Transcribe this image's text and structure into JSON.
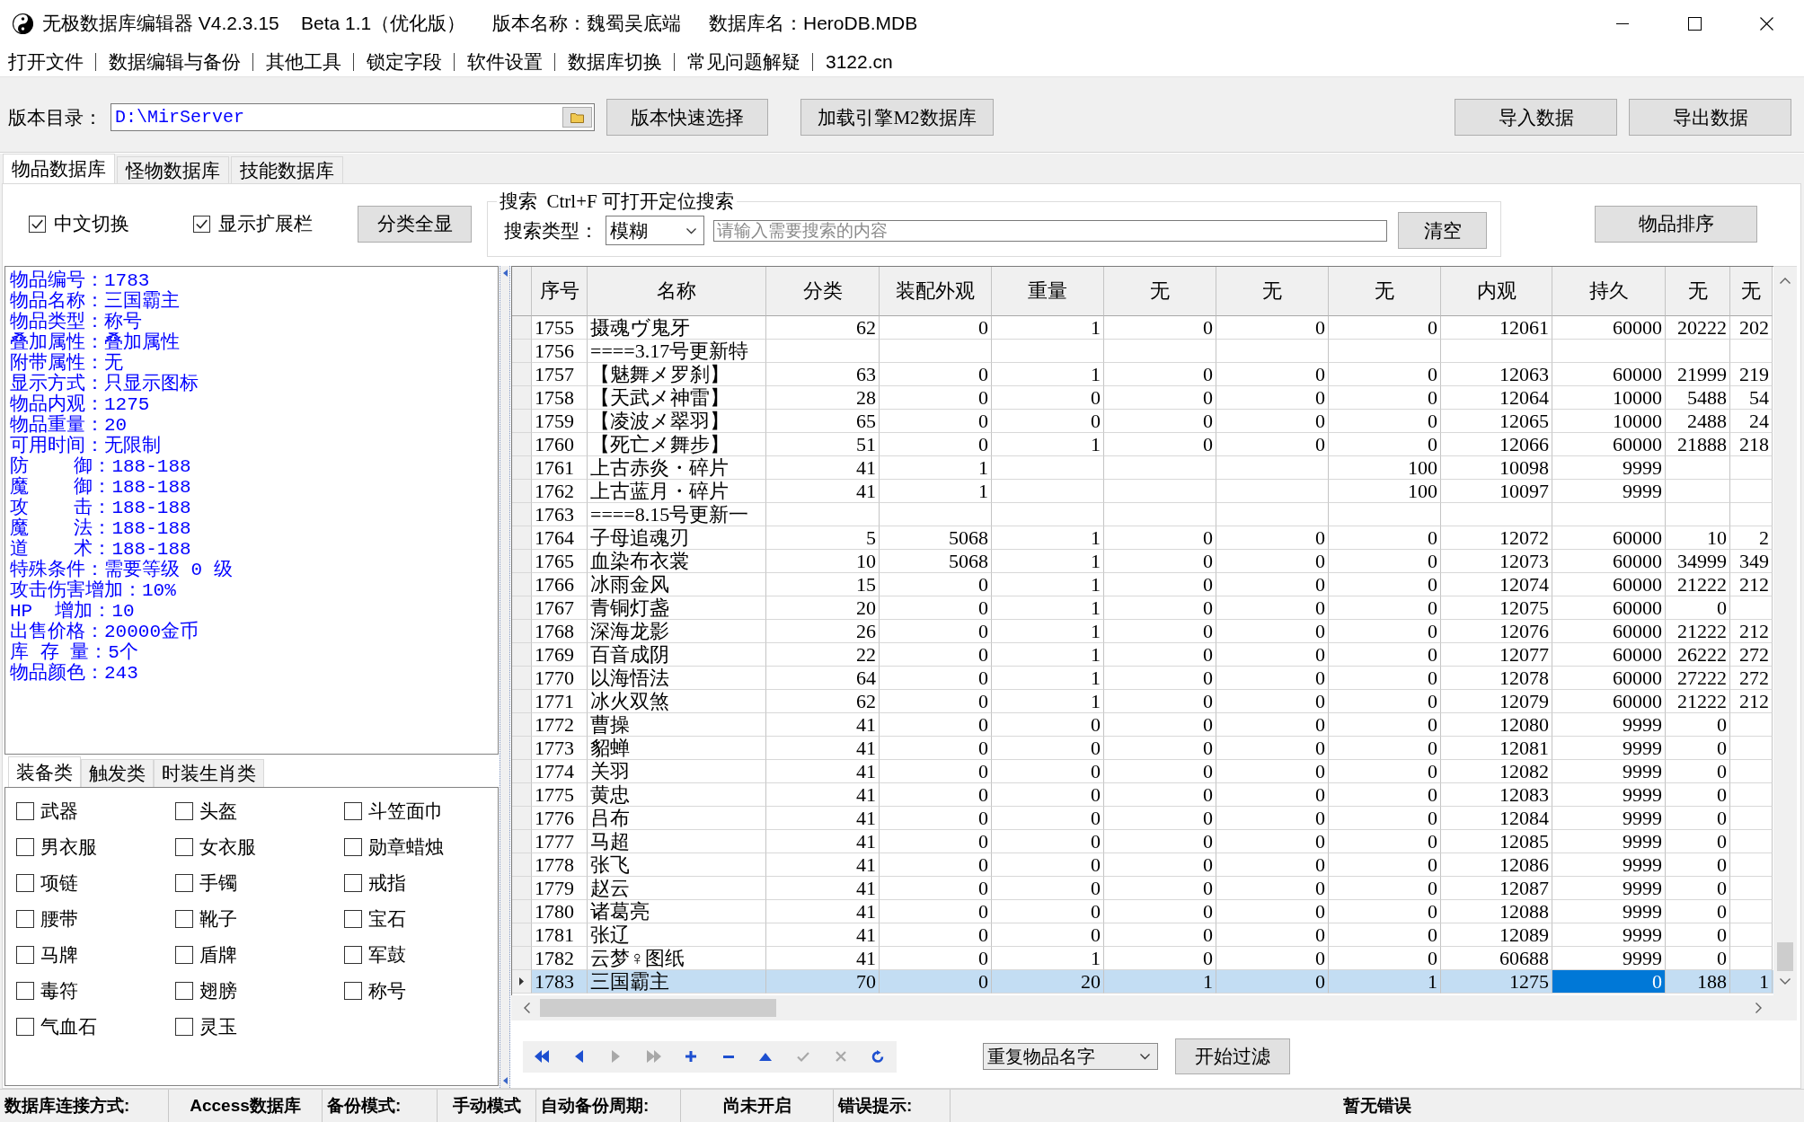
{
  "window": {
    "title": [
      "无极数据库编辑器 V4.2.3.15",
      "Beta 1.1（优化版）",
      "版本名称：魏蜀吴底端",
      "数据库名：HeroDB.MDB"
    ]
  },
  "menu": [
    "打开文件",
    "数据编辑与备份",
    "其他工具",
    "锁定字段",
    "软件设置",
    "数据库切换",
    "常见问题解疑",
    "3122.cn"
  ],
  "toolbar": {
    "directory_label": "版本目录：",
    "directory": "D:\\MirServer",
    "buttons": [
      "版本快速选择",
      "加载引擎M2数据库"
    ],
    "data_buttons": [
      "导入数据",
      "导出数据"
    ]
  },
  "tabs": [
    {
      "label": "物品数据库",
      "selected": true
    },
    {
      "label": "怪物数据库",
      "selected": false
    },
    {
      "label": "技能数据库",
      "selected": false
    }
  ],
  "options": {
    "checkboxes": [
      {
        "label": "中文切换",
        "checked": true
      },
      {
        "label": "显示扩展栏",
        "checked": true
      }
    ],
    "show_all_button": "分类全显",
    "search": {
      "title": "搜索  Ctrl+F 可打开定位搜索",
      "type_label": "搜索类型：",
      "type_value": "模糊",
      "placeholder": "请输入需要搜索的内容",
      "clear_button": "清空"
    },
    "sort_button": "物品排序"
  },
  "info_panel": {
    "lines": [
      "物品编号：1783",
      "物品名称：三国霸主",
      "物品类型：称号",
      "叠加属性：叠加属性",
      "附带属性：无",
      "显示方式：只显示图标",
      "物品内观：1275",
      "物品重量：20",
      "可用时间：无限制",
      "防    御：188-188",
      "魔    御：188-188",
      "攻    击：188-188",
      "魔    法：188-188",
      "道    术：188-188",
      "特殊条件：需要等级 0 级",
      "攻击伤害增加：10%",
      "HP  增加：10",
      "出售价格：20000金币",
      "库 存 量：5个",
      "物品颜色：243"
    ]
  },
  "category_tabs": [
    {
      "label": "装备类",
      "selected": true
    },
    {
      "label": "触发类",
      "selected": false
    },
    {
      "label": "时装生肖类",
      "selected": false
    }
  ],
  "categories": [
    {
      "label": "武器",
      "checked": false
    },
    {
      "label": "头盔",
      "checked": false
    },
    {
      "label": "斗笠面巾",
      "checked": false
    },
    {
      "label": "男衣服",
      "checked": false
    },
    {
      "label": "女衣服",
      "checked": false
    },
    {
      "label": "勋章蜡烛",
      "checked": false
    },
    {
      "label": "项链",
      "checked": false
    },
    {
      "label": "手镯",
      "checked": false
    },
    {
      "label": "戒指",
      "checked": false
    },
    {
      "label": "腰带",
      "checked": false
    },
    {
      "label": "靴子",
      "checked": false
    },
    {
      "label": "宝石",
      "checked": false
    },
    {
      "label": "马牌",
      "checked": false
    },
    {
      "label": "盾牌",
      "checked": false
    },
    {
      "label": "军鼓",
      "checked": false
    },
    {
      "label": "毒符",
      "checked": false
    },
    {
      "label": "翅膀",
      "checked": false
    },
    {
      "label": "称号",
      "checked": false
    },
    {
      "label": "气血石",
      "checked": false
    },
    {
      "label": "灵玉",
      "checked": false
    }
  ],
  "table": {
    "columns": [
      {
        "label": "序号",
        "kind": "text",
        "focused": false
      },
      {
        "label": "名称",
        "kind": "text",
        "focused": false
      },
      {
        "label": "分类",
        "kind": "number",
        "focused": false
      },
      {
        "label": "装配外观",
        "kind": "number",
        "focused": false
      },
      {
        "label": "重量",
        "kind": "number",
        "focused": false
      },
      {
        "label": "无",
        "kind": "number",
        "focused": false
      },
      {
        "label": "无",
        "kind": "number",
        "focused": false
      },
      {
        "label": "无",
        "kind": "number",
        "focused": false
      },
      {
        "label": "内观",
        "kind": "number",
        "focused": false
      },
      {
        "label": "持久",
        "kind": "number",
        "focused": true
      },
      {
        "label": "无",
        "kind": "number",
        "focused": false
      },
      {
        "label": "无",
        "kind": "number",
        "focused": false
      }
    ],
    "rows": [
      {
        "selected": false,
        "cells": [
          "1755",
          "摄魂ヴ鬼牙",
          "62",
          "0",
          "1",
          "0",
          "0",
          "0",
          "12061",
          "60000",
          "20222",
          "202"
        ]
      },
      {
        "selected": false,
        "cells": [
          "1756",
          "====3.17号更新特",
          null,
          null,
          null,
          null,
          null,
          null,
          null,
          null,
          null,
          null
        ]
      },
      {
        "selected": false,
        "cells": [
          "1757",
          "【魅舞メ罗刹】",
          "63",
          "0",
          "1",
          "0",
          "0",
          "0",
          "12063",
          "60000",
          "21999",
          "219"
        ]
      },
      {
        "selected": false,
        "cells": [
          "1758",
          "【天武メ神雷】",
          "28",
          "0",
          "0",
          "0",
          "0",
          "0",
          "12064",
          "10000",
          "5488",
          "54"
        ]
      },
      {
        "selected": false,
        "cells": [
          "1759",
          "【凌波メ翠羽】",
          "65",
          "0",
          "0",
          "0",
          "0",
          "0",
          "12065",
          "10000",
          "2488",
          "24"
        ]
      },
      {
        "selected": false,
        "cells": [
          "1760",
          "【死亡メ舞步】",
          "51",
          "0",
          "1",
          "0",
          "0",
          "0",
          "12066",
          "60000",
          "21888",
          "218"
        ]
      },
      {
        "selected": false,
        "cells": [
          "1761",
          "上古赤炎・碎片",
          "41",
          "1",
          null,
          null,
          null,
          "100",
          "10098",
          "9999",
          null,
          null
        ]
      },
      {
        "selected": false,
        "cells": [
          "1762",
          "上古蓝月・碎片",
          "41",
          "1",
          null,
          null,
          null,
          "100",
          "10097",
          "9999",
          null,
          null
        ]
      },
      {
        "selected": false,
        "cells": [
          "1763",
          "====8.15号更新一",
          null,
          null,
          null,
          null,
          null,
          null,
          null,
          null,
          null,
          null
        ]
      },
      {
        "selected": false,
        "cells": [
          "1764",
          "子母追魂刃",
          "5",
          "5068",
          "1",
          "0",
          "0",
          "0",
          "12072",
          "60000",
          "10",
          "2"
        ]
      },
      {
        "selected": false,
        "cells": [
          "1765",
          "血染布衣裳",
          "10",
          "5068",
          "1",
          "0",
          "0",
          "0",
          "12073",
          "60000",
          "34999",
          "349"
        ]
      },
      {
        "selected": false,
        "cells": [
          "1766",
          "冰雨金风",
          "15",
          "0",
          "1",
          "0",
          "0",
          "0",
          "12074",
          "60000",
          "21222",
          "212"
        ]
      },
      {
        "selected": false,
        "cells": [
          "1767",
          "青铜灯盏",
          "20",
          "0",
          "1",
          "0",
          "0",
          "0",
          "12075",
          "60000",
          "0",
          null
        ]
      },
      {
        "selected": false,
        "cells": [
          "1768",
          "深海龙影",
          "26",
          "0",
          "1",
          "0",
          "0",
          "0",
          "12076",
          "60000",
          "21222",
          "212"
        ]
      },
      {
        "selected": false,
        "cells": [
          "1769",
          "百音成阴",
          "22",
          "0",
          "1",
          "0",
          "0",
          "0",
          "12077",
          "60000",
          "26222",
          "272"
        ]
      },
      {
        "selected": false,
        "cells": [
          "1770",
          "以海悟法",
          "64",
          "0",
          "1",
          "0",
          "0",
          "0",
          "12078",
          "60000",
          "27222",
          "272"
        ]
      },
      {
        "selected": false,
        "cells": [
          "1771",
          "冰火双煞",
          "62",
          "0",
          "1",
          "0",
          "0",
          "0",
          "12079",
          "60000",
          "21222",
          "212"
        ]
      },
      {
        "selected": false,
        "cells": [
          "1772",
          "曹操",
          "41",
          "0",
          "0",
          "0",
          "0",
          "0",
          "12080",
          "9999",
          "0",
          null
        ]
      },
      {
        "selected": false,
        "cells": [
          "1773",
          "貂蝉",
          "41",
          "0",
          "0",
          "0",
          "0",
          "0",
          "12081",
          "9999",
          "0",
          null
        ]
      },
      {
        "selected": false,
        "cells": [
          "1774",
          "关羽",
          "41",
          "0",
          "0",
          "0",
          "0",
          "0",
          "12082",
          "9999",
          "0",
          null
        ]
      },
      {
        "selected": false,
        "cells": [
          "1775",
          "黄忠",
          "41",
          "0",
          "0",
          "0",
          "0",
          "0",
          "12083",
          "9999",
          "0",
          null
        ]
      },
      {
        "selected": false,
        "cells": [
          "1776",
          "吕布",
          "41",
          "0",
          "0",
          "0",
          "0",
          "0",
          "12084",
          "9999",
          "0",
          null
        ]
      },
      {
        "selected": false,
        "cells": [
          "1777",
          "马超",
          "41",
          "0",
          "0",
          "0",
          "0",
          "0",
          "12085",
          "9999",
          "0",
          null
        ]
      },
      {
        "selected": false,
        "cells": [
          "1778",
          "张飞",
          "41",
          "0",
          "0",
          "0",
          "0",
          "0",
          "12086",
          "9999",
          "0",
          null
        ]
      },
      {
        "selected": false,
        "cells": [
          "1779",
          "赵云",
          "41",
          "0",
          "0",
          "0",
          "0",
          "0",
          "12087",
          "9999",
          "0",
          null
        ]
      },
      {
        "selected": false,
        "cells": [
          "1780",
          "诸葛亮",
          "41",
          "0",
          "0",
          "0",
          "0",
          "0",
          "12088",
          "9999",
          "0",
          null
        ]
      },
      {
        "selected": false,
        "cells": [
          "1781",
          "张辽",
          "41",
          "0",
          "0",
          "0",
          "0",
          "0",
          "12089",
          "9999",
          "0",
          null
        ]
      },
      {
        "selected": false,
        "cells": [
          "1782",
          "云梦♀图纸",
          "41",
          "0",
          "1",
          "0",
          "0",
          "0",
          "60688",
          "9999",
          "0",
          null
        ]
      },
      {
        "selected": true,
        "cells": [
          "1783",
          "三国霸主",
          "70",
          "0",
          "20",
          "1",
          "0",
          "1",
          "1275",
          "0",
          "188",
          "1"
        ]
      }
    ]
  },
  "footer": {
    "navigator": [
      {
        "disabled": false
      },
      {
        "disabled": false
      },
      {
        "disabled": true
      },
      {
        "disabled": true
      },
      {
        "disabled": false
      },
      {
        "disabled": false
      },
      {
        "disabled": false
      },
      {
        "disabled": true
      },
      {
        "disabled": true
      },
      {
        "disabled": false
      }
    ],
    "filter_select": "重复物品名字",
    "filter_button": "开始过滤"
  },
  "status_bar": [
    "数据库连接方式:",
    "Access数据库",
    "备份模式:",
    "手动模式",
    "自动备份周期:",
    "尚未开启",
    "错误提示:",
    "暂无错误"
  ]
}
